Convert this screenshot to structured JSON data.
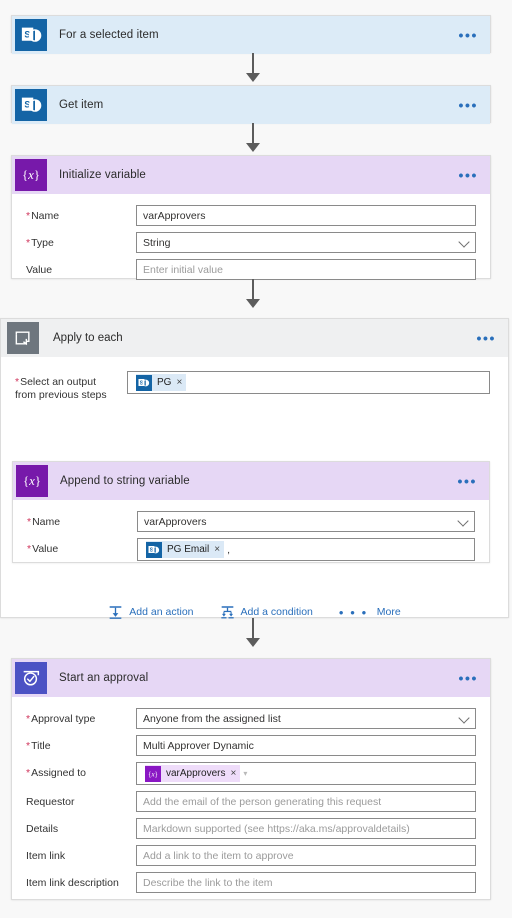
{
  "flow": {
    "steps": [
      {
        "id": "for-a-selected-item",
        "title": "For a selected item",
        "icon": "sharepoint-icon",
        "header_color": "#dcebf7",
        "tile_color": "#1464a5",
        "menu_label": "•••"
      },
      {
        "id": "get-item",
        "title": "Get item",
        "icon": "sharepoint-icon",
        "header_color": "#dcebf7",
        "tile_color": "#1464a5",
        "menu_label": "•••"
      },
      {
        "id": "initialize-variable",
        "title": "Initialize variable",
        "icon": "variable-braces-icon",
        "header_color": "#e6d7f5",
        "tile_color": "#7719aa",
        "menu_label": "•••",
        "fields": [
          {
            "label": "Name",
            "required": true,
            "value": "varApprovers",
            "placeholder": "",
            "control": "text"
          },
          {
            "label": "Type",
            "required": true,
            "value": "String",
            "placeholder": "",
            "control": "dropdown"
          },
          {
            "label": "Value",
            "required": false,
            "value": "",
            "placeholder": "Enter initial value",
            "control": "text"
          }
        ]
      }
    ],
    "scope": {
      "id": "apply-to-each",
      "title": "Apply to each",
      "icon": "loop-icon",
      "header_color": "#eff0f1",
      "tile_color": "#6e767e",
      "menu_label": "•••",
      "select_output": {
        "label_line1": "Select an output",
        "label_line2": "from previous steps",
        "required": true,
        "token": {
          "text": "PG",
          "icon": "sharepoint-icon",
          "remove_label": "×",
          "style": "blue"
        }
      },
      "inner_action": {
        "id": "append-to-string-variable",
        "title": "Append to string variable",
        "icon": "variable-braces-icon",
        "header_color": "#e6d7f5",
        "tile_color": "#7719aa",
        "menu_label": "•••",
        "fields": [
          {
            "label": "Name",
            "required": true,
            "value": "varApprovers",
            "control": "dropdown"
          },
          {
            "label": "Value",
            "required": true,
            "control": "token",
            "token": {
              "text": "PG Email",
              "icon": "sharepoint-icon",
              "remove_label": "×",
              "style": "blue"
            },
            "trailing_text": ","
          }
        ]
      },
      "footer_actions": [
        {
          "id": "add-an-action",
          "label": "Add an action",
          "icon": "add-action-icon"
        },
        {
          "id": "add-a-condition",
          "label": "Add a condition",
          "icon": "add-condition-icon"
        },
        {
          "id": "more",
          "label": "More",
          "icon": "more-dots-icon",
          "dots": "• • •"
        }
      ]
    },
    "approval": {
      "id": "start-an-approval",
      "title": "Start an approval",
      "icon": "approval-check-icon",
      "header_color": "#e6d7f5",
      "tile_color": "#4c52c4",
      "menu_label": "•••",
      "fields": [
        {
          "label": "Approval type",
          "required": true,
          "value": "Anyone from the assigned list",
          "control": "dropdown"
        },
        {
          "label": "Title",
          "required": true,
          "value": "Multi Approver Dynamic",
          "control": "text"
        },
        {
          "label": "Assigned to",
          "required": true,
          "control": "token",
          "token": {
            "text": "varApprovers",
            "icon": "variable-braces-icon",
            "remove_label": "×",
            "style": "lilac"
          }
        },
        {
          "label": "Requestor",
          "required": false,
          "value": "",
          "placeholder": "Add the email of the person generating this request",
          "control": "text"
        },
        {
          "label": "Details",
          "required": false,
          "value": "",
          "placeholder": "Markdown supported (see https://aka.ms/approvaldetails)",
          "control": "text"
        },
        {
          "label": "Item link",
          "required": false,
          "value": "",
          "placeholder": "Add a link to the item to approve",
          "control": "text"
        },
        {
          "label": "Item link description",
          "required": false,
          "value": "",
          "placeholder": "Describe the link to the item",
          "control": "text"
        }
      ]
    }
  },
  "theme": {
    "canvas_bg": "#f8f8f8",
    "accent_link": "#2a6fbb",
    "required_marker": "#d0355c",
    "connector": "#5c5c5c"
  }
}
